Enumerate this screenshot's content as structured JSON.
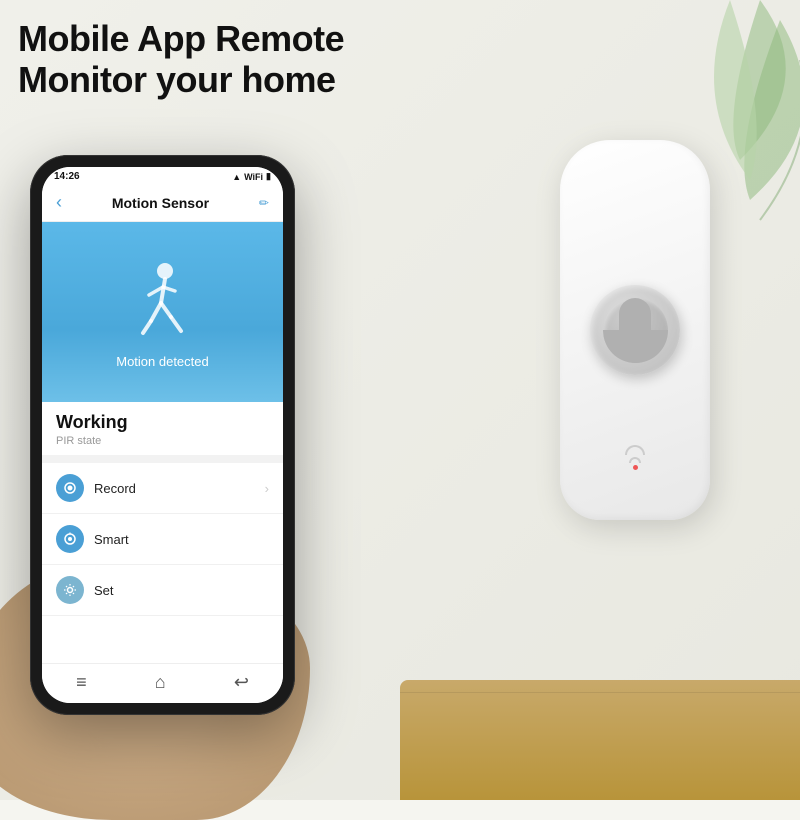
{
  "heading": {
    "line1": "Mobile App Remote",
    "line2": "Monitor your home"
  },
  "phone": {
    "status_bar": {
      "time": "14:26",
      "icons": "▲ WiFi Batt"
    },
    "app_header": {
      "back_label": "‹",
      "title": "Motion Sensor",
      "edit_label": "✏"
    },
    "motion": {
      "detected_text": "Motion detected"
    },
    "status_card": {
      "working_label": "Working",
      "pir_label": "PIR state"
    },
    "menu_items": [
      {
        "label": "Record",
        "has_chevron": true,
        "icon_type": "record"
      },
      {
        "label": "Smart",
        "has_chevron": false,
        "icon_type": "smart"
      },
      {
        "label": "Set",
        "has_chevron": false,
        "icon_type": "gear"
      }
    ],
    "nav": {
      "home_icon": "⌂",
      "menu_icon": "≡",
      "back_icon": "↩"
    }
  },
  "device": {
    "wifi_dot_color": "#e55555"
  }
}
